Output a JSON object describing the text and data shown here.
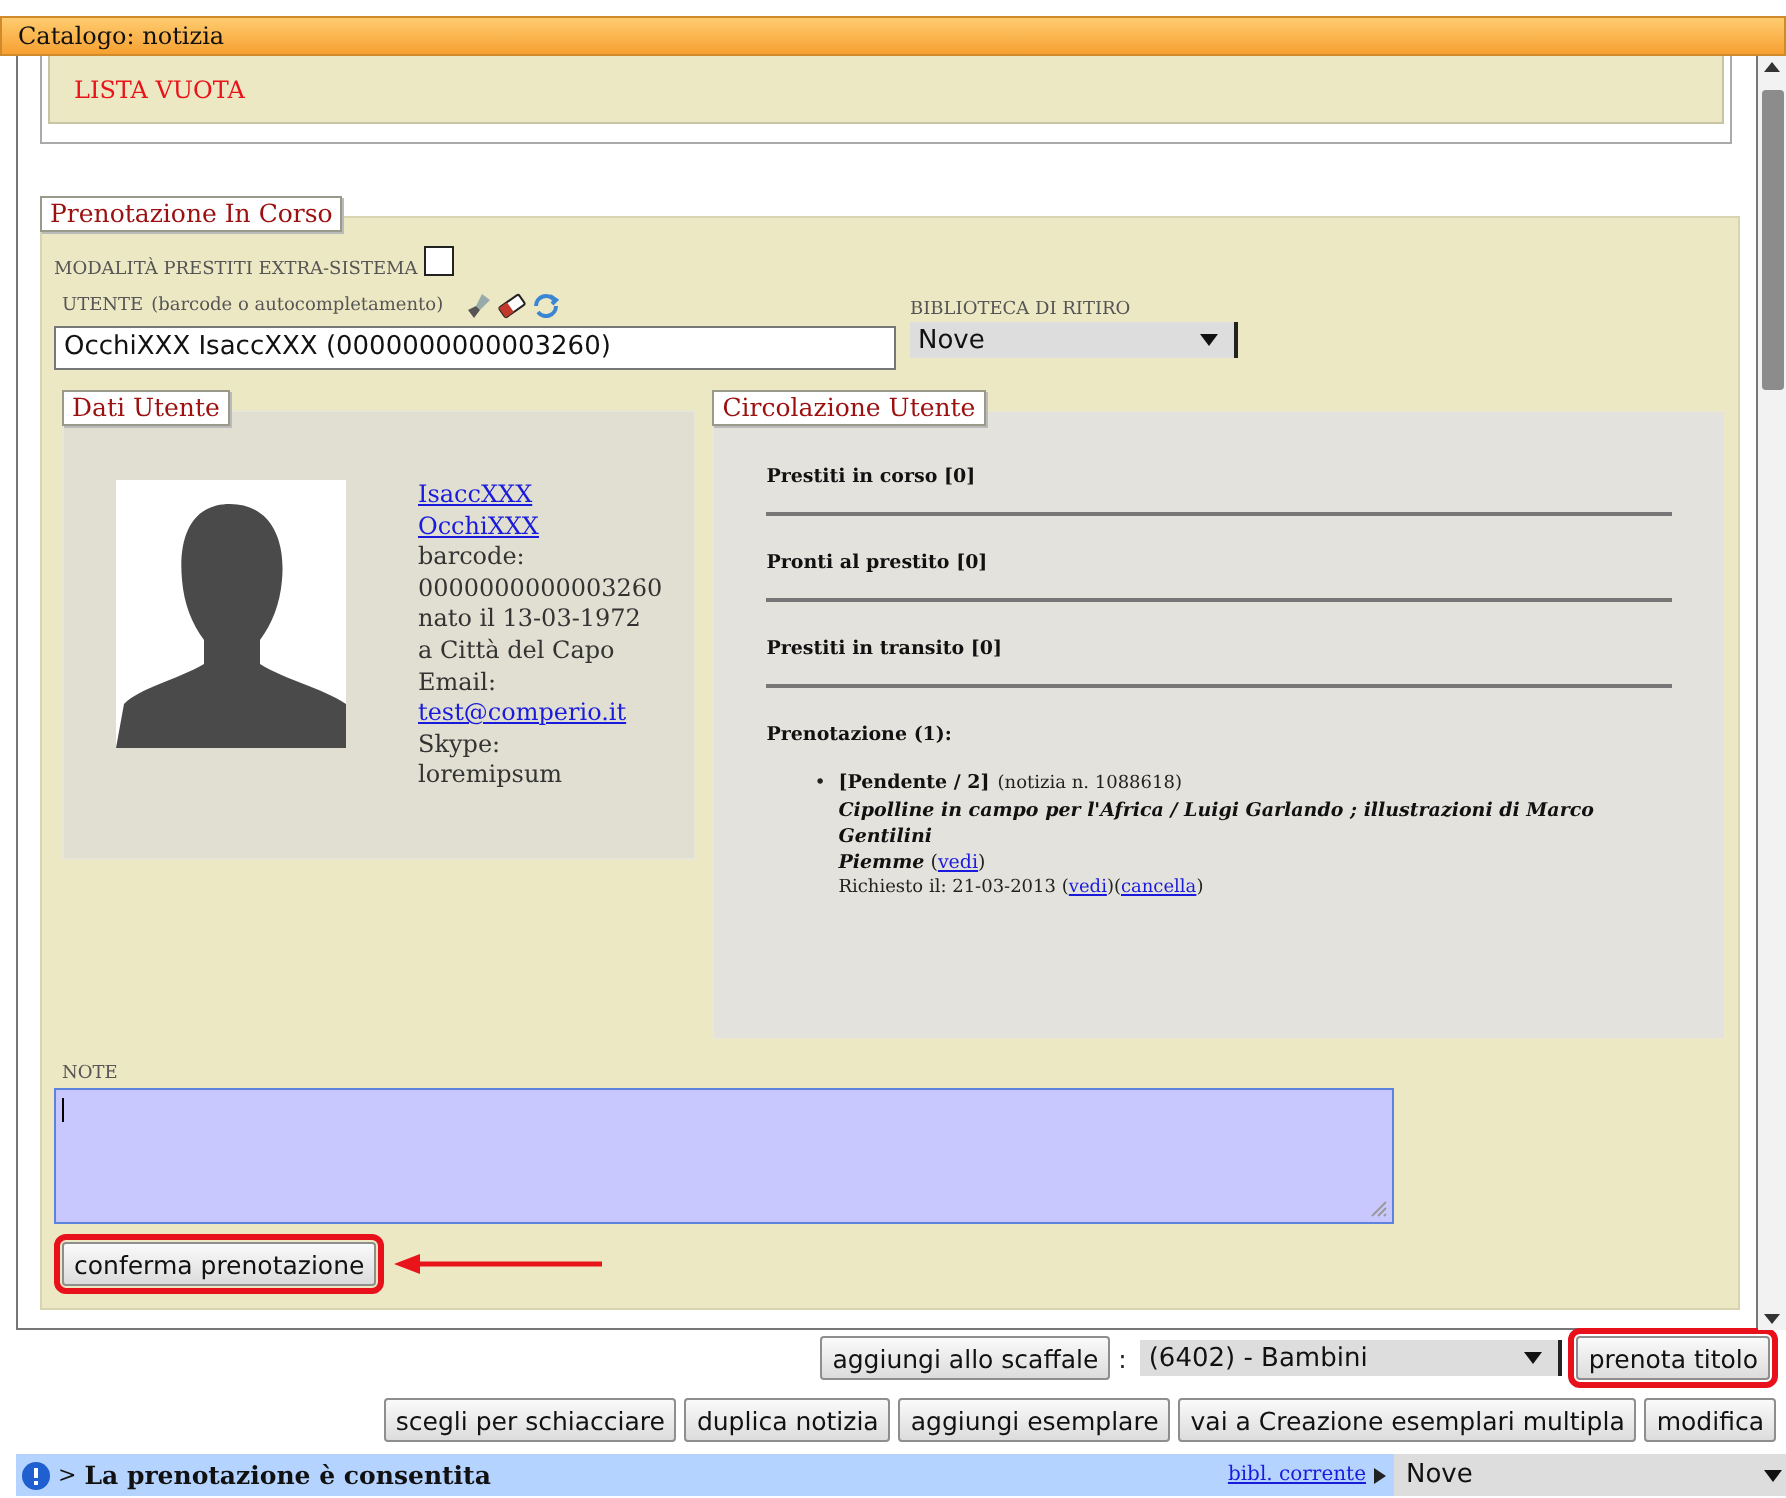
{
  "window": {
    "title": "Catalogo: notizia"
  },
  "shelf_list": {
    "message": "LISTA VUOTA"
  },
  "reservation": {
    "legend": "Prenotazione In Corso",
    "extra_system": {
      "label": "MODALITÀ PRESTITI EXTRA-SISTEMA",
      "checked": false
    },
    "user_field": {
      "label": "UTENTE",
      "hint": "(barcode o autocompletamento)",
      "value": "OcchiXXX IsaccXXX (0000000000003260)"
    },
    "pickup_library": {
      "label": "BIBLIOTECA DI RITIRO",
      "value": "Nove"
    },
    "user_data": {
      "legend": "Dati Utente",
      "lines": [
        {
          "text": "IsaccXXX",
          "kind": "link"
        },
        {
          "text": "OcchiXXX",
          "kind": "link"
        },
        {
          "text": "barcode:",
          "kind": "text"
        },
        {
          "text": "0000000000003260",
          "kind": "text"
        },
        {
          "text": "nato il 13-03-1972",
          "kind": "text"
        },
        {
          "text": "a Città del Capo",
          "kind": "text"
        },
        {
          "text": "Email:",
          "kind": "text"
        },
        {
          "text": "test@comperio.it",
          "kind": "link"
        },
        {
          "text": "Skype:",
          "kind": "text"
        },
        {
          "text": "loremipsum",
          "kind": "text"
        }
      ]
    },
    "circulation": {
      "legend": "Circolazione Utente",
      "sections": [
        "Prestiti in corso [0]",
        "Pronti al prestito [0]",
        "Prestiti in transito [0]"
      ],
      "reservations_heading": "Prenotazione (1):",
      "reservations": [
        {
          "bullet": "•",
          "status": "[Pendente / 2]",
          "record": "(notizia n. 1088618)",
          "title": "Cipolline in campo per l'Africa / Luigi Garlando ; illustrazioni di Marco Gentilini",
          "publisher": "Piemme",
          "publisher_links": [
            {
              "before": "(",
              "text": "vedi",
              "after": ")"
            }
          ],
          "requested": "Richiesto il: 21-03-2013",
          "links": [
            {
              "before": "(",
              "text": "vedi",
              "after": ")"
            },
            {
              "before": "(",
              "text": "cancella",
              "after": ")"
            }
          ]
        }
      ]
    },
    "note": {
      "label": "NOTE",
      "focused": true
    },
    "confirm_button": {
      "label": "conferma prenotazione",
      "highlighted": true
    }
  },
  "shelf_bar": {
    "button": {
      "label": "aggiungi allo scaffale",
      "highlighted": false
    },
    "separator": ":",
    "shelf": "(6402) - Bambini",
    "reserve_button": {
      "label": "prenota titolo",
      "highlighted": true
    }
  },
  "actions": [
    {
      "label": "scegli per schiacciare"
    },
    {
      "label": "duplica notizia"
    },
    {
      "label": "aggiungi esemplare"
    },
    {
      "label": "vai a Creazione esemplari multipla"
    },
    {
      "label": "modifica"
    }
  ],
  "status_bar": {
    "prefix": ">",
    "message": "La prenotazione è consentita",
    "link": "bibl. corrente",
    "library": "Nove"
  }
}
